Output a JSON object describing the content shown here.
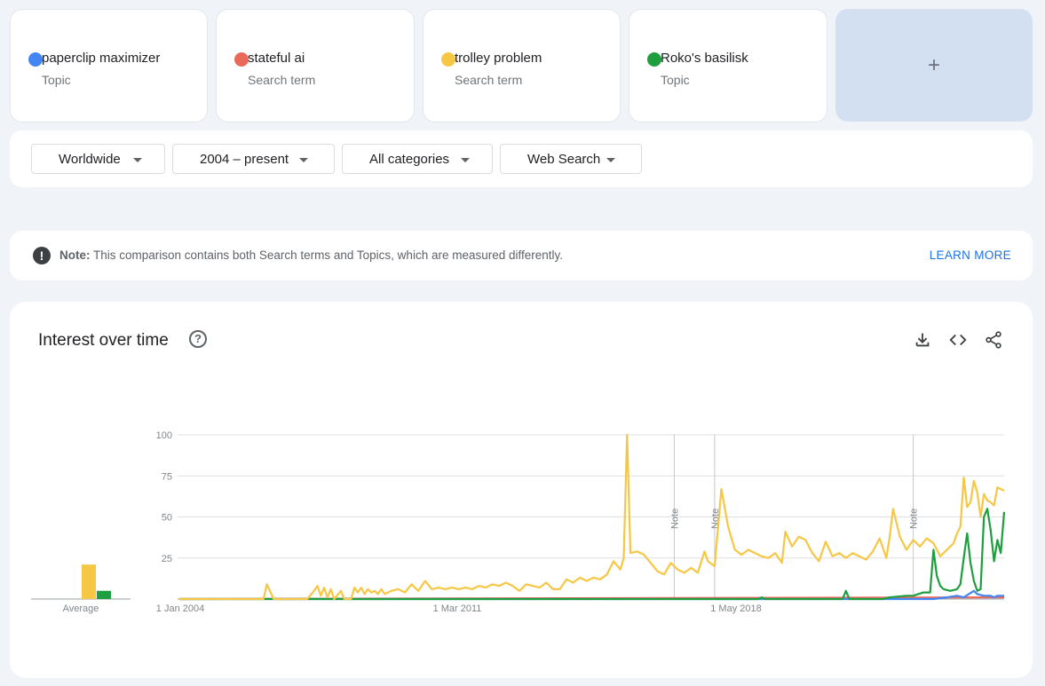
{
  "terms": [
    {
      "name": "paperclip maximizer",
      "type": "Topic",
      "color": "#4285f4"
    },
    {
      "name": "stateful ai",
      "type": "Search term",
      "color": "#ea6a5a"
    },
    {
      "name": "trolley problem",
      "type": "Search term",
      "color": "#f6c744"
    },
    {
      "name": "Roko's basilisk",
      "type": "Topic",
      "color": "#1e9e3e"
    }
  ],
  "add_label": "+",
  "filters": {
    "region": "Worldwide",
    "time": "2004 – present",
    "category": "All categories",
    "property": "Web Search"
  },
  "note": {
    "label": "Note:",
    "text": "This comparison contains both Search terms and Topics, which are measured differently.",
    "link": "LEARN MORE"
  },
  "chart_title": "Interest over time",
  "icons": {
    "help": "help-circle-icon",
    "download": "download-icon",
    "embed": "embed-code-icon",
    "share": "share-icon"
  },
  "chart_data": {
    "type": "line",
    "title": "Interest over time",
    "x_start": "2004-01",
    "x_end": "2024-06",
    "x_tick_labels": [
      "1 Jan 2004",
      "1 Mar 2011",
      "1 May 2018"
    ],
    "y_ticks": [
      100,
      75,
      50,
      25
    ],
    "ylim": [
      0,
      100
    ],
    "grid": true,
    "notes": [
      {
        "date": "2016-04",
        "label": "Note"
      },
      {
        "date": "2017-04",
        "label": "Note"
      },
      {
        "date": "2022-03",
        "label": "Note"
      }
    ],
    "average": {
      "label": "Average",
      "values": [
        {
          "series": "trolley problem",
          "value": 21,
          "color": "#f6c744"
        },
        {
          "series": "Roko's basilisk",
          "value": 5,
          "color": "#1e9e3e"
        }
      ]
    },
    "series": [
      {
        "name": "trolley problem",
        "color": "#f6c744",
        "points": [
          [
            "2004-01",
            0
          ],
          [
            "2006-02",
            0
          ],
          [
            "2006-03",
            9
          ],
          [
            "2006-05",
            0
          ],
          [
            "2007-01",
            0
          ],
          [
            "2007-03",
            0
          ],
          [
            "2007-05",
            5
          ],
          [
            "2007-06",
            8
          ],
          [
            "2007-07",
            2
          ],
          [
            "2007-08",
            7
          ],
          [
            "2007-09",
            1
          ],
          [
            "2007-10",
            6
          ],
          [
            "2007-11",
            0
          ],
          [
            "2008-01",
            5
          ],
          [
            "2008-02",
            0
          ],
          [
            "2008-04",
            0
          ],
          [
            "2008-05",
            7
          ],
          [
            "2008-06",
            4
          ],
          [
            "2008-07",
            7
          ],
          [
            "2008-08",
            3
          ],
          [
            "2008-09",
            6
          ],
          [
            "2008-10",
            4
          ],
          [
            "2008-11",
            5
          ],
          [
            "2008-12",
            3
          ],
          [
            "2009-01",
            6
          ],
          [
            "2009-02",
            3
          ],
          [
            "2009-04",
            5
          ],
          [
            "2009-06",
            6
          ],
          [
            "2009-08",
            4
          ],
          [
            "2009-10",
            9
          ],
          [
            "2009-12",
            5
          ],
          [
            "2010-02",
            11
          ],
          [
            "2010-04",
            6
          ],
          [
            "2010-06",
            7
          ],
          [
            "2010-08",
            6
          ],
          [
            "2010-10",
            7
          ],
          [
            "2010-12",
            6
          ],
          [
            "2011-02",
            7
          ],
          [
            "2011-04",
            6
          ],
          [
            "2011-06",
            8
          ],
          [
            "2011-08",
            7
          ],
          [
            "2011-10",
            9
          ],
          [
            "2011-12",
            8
          ],
          [
            "2012-02",
            10
          ],
          [
            "2012-04",
            8
          ],
          [
            "2012-06",
            5
          ],
          [
            "2012-08",
            9
          ],
          [
            "2012-10",
            8
          ],
          [
            "2012-12",
            7
          ],
          [
            "2013-02",
            10
          ],
          [
            "2013-04",
            6
          ],
          [
            "2013-06",
            6
          ],
          [
            "2013-08",
            12
          ],
          [
            "2013-10",
            10
          ],
          [
            "2013-12",
            13
          ],
          [
            "2014-02",
            11
          ],
          [
            "2014-04",
            13
          ],
          [
            "2014-06",
            12
          ],
          [
            "2014-08",
            15
          ],
          [
            "2014-10",
            23
          ],
          [
            "2014-12",
            18
          ],
          [
            "2015-01",
            25
          ],
          [
            "2015-02",
            100
          ],
          [
            "2015-03",
            28
          ],
          [
            "2015-05",
            29
          ],
          [
            "2015-07",
            27
          ],
          [
            "2015-09",
            22
          ],
          [
            "2015-11",
            17
          ],
          [
            "2016-01",
            15
          ],
          [
            "2016-03",
            22
          ],
          [
            "2016-05",
            18
          ],
          [
            "2016-07",
            16
          ],
          [
            "2016-09",
            19
          ],
          [
            "2016-11",
            16
          ],
          [
            "2017-01",
            29
          ],
          [
            "2017-02",
            23
          ],
          [
            "2017-04",
            20
          ],
          [
            "2017-06",
            67
          ],
          [
            "2017-08",
            44
          ],
          [
            "2017-10",
            30
          ],
          [
            "2017-12",
            27
          ],
          [
            "2018-02",
            30
          ],
          [
            "2018-04",
            28
          ],
          [
            "2018-06",
            26
          ],
          [
            "2018-08",
            25
          ],
          [
            "2018-10",
            28
          ],
          [
            "2018-12",
            22
          ],
          [
            "2019-01",
            41
          ],
          [
            "2019-03",
            32
          ],
          [
            "2019-05",
            38
          ],
          [
            "2019-07",
            36
          ],
          [
            "2019-09",
            28
          ],
          [
            "2019-11",
            23
          ],
          [
            "2020-01",
            35
          ],
          [
            "2020-03",
            26
          ],
          [
            "2020-05",
            28
          ],
          [
            "2020-07",
            25
          ],
          [
            "2020-09",
            28
          ],
          [
            "2020-11",
            26
          ],
          [
            "2021-01",
            24
          ],
          [
            "2021-03",
            29
          ],
          [
            "2021-05",
            37
          ],
          [
            "2021-07",
            25
          ],
          [
            "2021-08",
            38
          ],
          [
            "2021-09",
            55
          ],
          [
            "2021-11",
            38
          ],
          [
            "2022-01",
            30
          ],
          [
            "2022-03",
            36
          ],
          [
            "2022-05",
            32
          ],
          [
            "2022-07",
            37
          ],
          [
            "2022-09",
            34
          ],
          [
            "2022-11",
            26
          ],
          [
            "2023-01",
            30
          ],
          [
            "2023-03",
            34
          ],
          [
            "2023-04",
            40
          ],
          [
            "2023-05",
            44
          ],
          [
            "2023-06",
            74
          ],
          [
            "2023-07",
            56
          ],
          [
            "2023-08",
            59
          ],
          [
            "2023-09",
            72
          ],
          [
            "2023-10",
            65
          ],
          [
            "2023-11",
            50
          ],
          [
            "2023-12",
            64
          ],
          [
            "2024-01",
            60
          ],
          [
            "2024-02",
            59
          ],
          [
            "2024-03",
            57
          ],
          [
            "2024-04",
            68
          ],
          [
            "2024-05",
            67
          ],
          [
            "2024-06",
            66
          ]
        ]
      },
      {
        "name": "Roko's basilisk",
        "color": "#1e9e3e",
        "points": [
          [
            "2004-01",
            0
          ],
          [
            "2018-05",
            0
          ],
          [
            "2018-06",
            1
          ],
          [
            "2018-07",
            0
          ],
          [
            "2020-06",
            0
          ],
          [
            "2020-07",
            5
          ],
          [
            "2020-08",
            0
          ],
          [
            "2021-06",
            0
          ],
          [
            "2021-08",
            1
          ],
          [
            "2022-01",
            2
          ],
          [
            "2022-03",
            2
          ],
          [
            "2022-06",
            4
          ],
          [
            "2022-08",
            4
          ],
          [
            "2022-09",
            30
          ],
          [
            "2022-10",
            14
          ],
          [
            "2022-11",
            8
          ],
          [
            "2022-12",
            6
          ],
          [
            "2023-02",
            5
          ],
          [
            "2023-04",
            6
          ],
          [
            "2023-05",
            9
          ],
          [
            "2023-06",
            25
          ],
          [
            "2023-07",
            40
          ],
          [
            "2023-08",
            22
          ],
          [
            "2023-09",
            11
          ],
          [
            "2023-10",
            5
          ],
          [
            "2023-11",
            6
          ],
          [
            "2023-12",
            50
          ],
          [
            "2024-01",
            55
          ],
          [
            "2024-02",
            42
          ],
          [
            "2024-03",
            23
          ],
          [
            "2024-04",
            36
          ],
          [
            "2024-05",
            28
          ],
          [
            "2024-06",
            53
          ]
        ]
      },
      {
        "name": "paperclip maximizer",
        "color": "#4285f4",
        "points": [
          [
            "2004-01",
            0
          ],
          [
            "2022-09",
            0
          ],
          [
            "2023-01",
            1
          ],
          [
            "2023-04",
            2
          ],
          [
            "2023-06",
            1
          ],
          [
            "2023-09",
            5
          ],
          [
            "2023-10",
            3
          ],
          [
            "2023-12",
            2
          ],
          [
            "2024-02",
            2
          ],
          [
            "2024-03",
            1
          ],
          [
            "2024-04",
            2
          ],
          [
            "2024-06",
            2
          ]
        ]
      },
      {
        "name": "stateful ai",
        "color": "#ea6a5a",
        "points": [
          [
            "2004-01",
            0
          ],
          [
            "2024-06",
            1
          ]
        ]
      }
    ]
  }
}
